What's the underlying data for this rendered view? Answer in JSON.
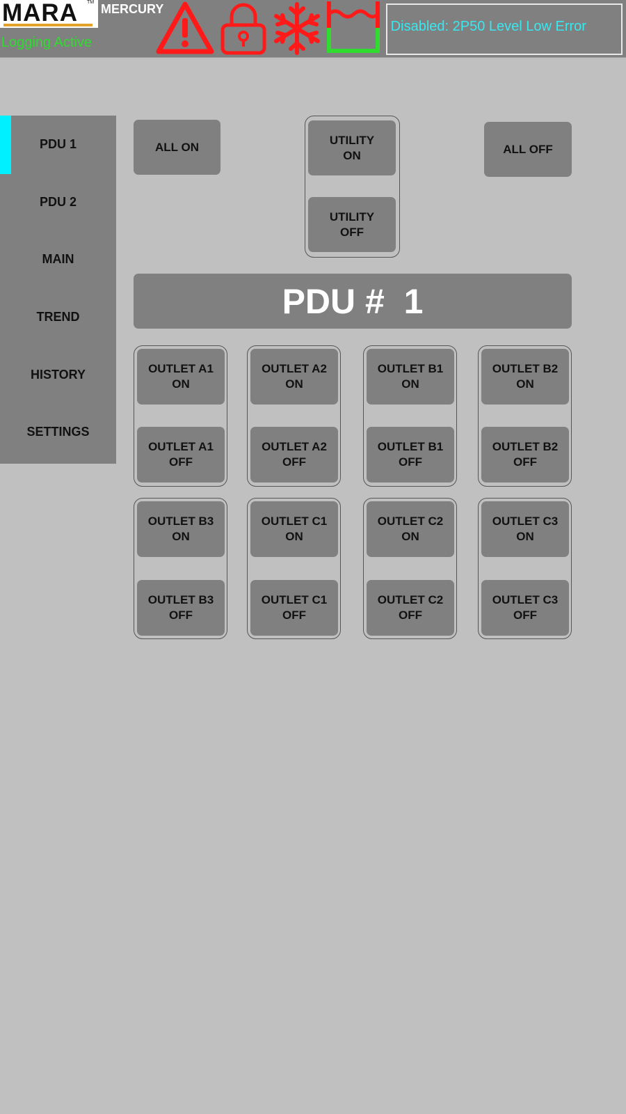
{
  "header": {
    "logo_text": "MARA",
    "logo_tm": "TM",
    "product_name": "MERCURY",
    "logging_status": "Logging Active",
    "ticker_message": "n Disabled: 2P50 Level Low Error",
    "status_icons": [
      "warning-icon",
      "lock-icon",
      "snowflake-icon",
      "tank-level-icon"
    ],
    "colors": {
      "alarm": "#ff1a1a",
      "ok": "#2fdc2f",
      "ticker": "#38e8f0"
    }
  },
  "sidebar": {
    "active_index": 0,
    "items": [
      {
        "label": "PDU 1"
      },
      {
        "label": "PDU 2"
      },
      {
        "label": "MAIN"
      },
      {
        "label": "TREND"
      },
      {
        "label": "HISTORY"
      },
      {
        "label": "SETTINGS"
      }
    ]
  },
  "controls": {
    "all_on": "ALL ON",
    "all_off": "ALL OFF",
    "utility_on": "UTILITY\nON",
    "utility_off": "UTILITY\nOFF"
  },
  "pdu_title": "PDU #  1",
  "outlets": [
    {
      "on": "OUTLET A1\nON",
      "off": "OUTLET A1\nOFF"
    },
    {
      "on": "OUTLET A2\nON",
      "off": "OUTLET A2\nOFF"
    },
    {
      "on": "OUTLET B1\nON",
      "off": "OUTLET B1\nOFF"
    },
    {
      "on": "OUTLET B2\nON",
      "off": "OUTLET B2\nOFF"
    },
    {
      "on": "OUTLET B3\nON",
      "off": "OUTLET B3\nOFF"
    },
    {
      "on": "OUTLET C1\nON",
      "off": "OUTLET C1\nOFF"
    },
    {
      "on": "OUTLET C2\nON",
      "off": "OUTLET C2\nOFF"
    },
    {
      "on": "OUTLET C3\nON",
      "off": "OUTLET C3\nOFF"
    }
  ]
}
